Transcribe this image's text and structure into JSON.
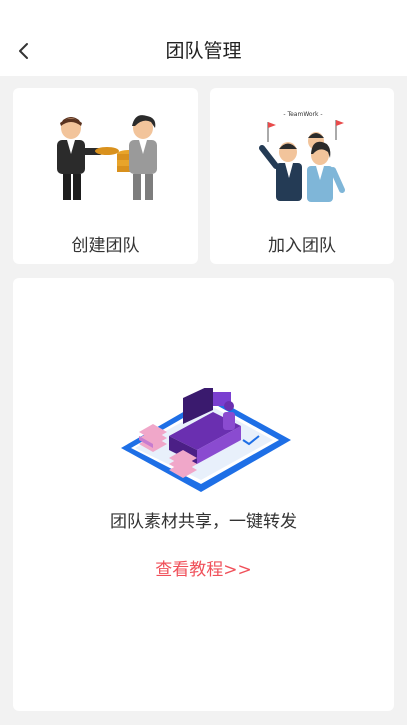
{
  "header": {
    "title": "团队管理",
    "back_icon": "chevron-left-icon"
  },
  "cards": {
    "create": {
      "label": "创建团队"
    },
    "join": {
      "label": "加入团队",
      "banner_text": "- TeamWork -"
    }
  },
  "share": {
    "description": "团队素材共享，一键转发",
    "tutorial_link": "查看教程>>"
  },
  "colors": {
    "link": "#f0505a",
    "page_bg": "#f2f2f2",
    "card_bg": "#ffffff"
  }
}
